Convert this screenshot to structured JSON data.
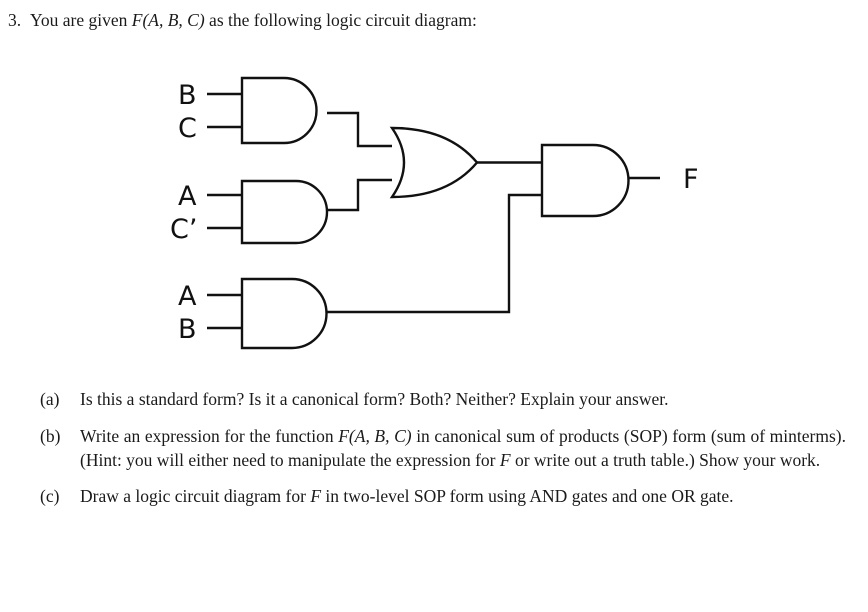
{
  "question": {
    "number": "3.",
    "stem_pre": "You are given ",
    "stem_func": "F(A, B, C)",
    "stem_post": " as the following logic circuit diagram:"
  },
  "circuit": {
    "title": "logic-circuit-diagram",
    "inputs": [
      {
        "label": "B",
        "gate": "and-gate-1",
        "pin": "top"
      },
      {
        "label": "C",
        "gate": "and-gate-1",
        "pin": "bottom"
      },
      {
        "label": "A",
        "gate": "and-gate-2",
        "pin": "top"
      },
      {
        "label": "C’",
        "gate": "and-gate-2",
        "pin": "bottom"
      },
      {
        "label": "A",
        "gate": "and-gate-3",
        "pin": "top"
      },
      {
        "label": "B",
        "gate": "and-gate-3",
        "pin": "bottom"
      }
    ],
    "gates": [
      {
        "name": "and-gate-1",
        "type": "AND",
        "inputs": [
          "B",
          "C"
        ]
      },
      {
        "name": "and-gate-2",
        "type": "AND",
        "inputs": [
          "A",
          "C’"
        ]
      },
      {
        "name": "and-gate-3",
        "type": "AND",
        "inputs": [
          "A",
          "B"
        ]
      },
      {
        "name": "or-gate-1",
        "type": "OR",
        "inputs": [
          "and-gate-1",
          "and-gate-2"
        ]
      },
      {
        "name": "and-gate-4",
        "type": "AND",
        "inputs": [
          "or-gate-1",
          "and-gate-3"
        ]
      }
    ],
    "output": {
      "label": "F",
      "from": "and-gate-4"
    },
    "stroke_color": "#111111"
  },
  "parts": [
    {
      "marker": "(a)",
      "text": "Is this a standard form?  Is it a canonical form?  Both?  Neither?  Explain your answer."
    },
    {
      "marker": "(b)",
      "text_1": "Write an expression for the function ",
      "text_func": "F(A, B, C)",
      "text_2": " in canonical sum of products (SOP) form (sum of minterms).  (Hint: you will either need to manipulate the expression for ",
      "text_var": "F",
      "text_3": " or write out a truth table.)  Show your work."
    },
    {
      "marker": "(c)",
      "text_1": "Draw a logic circuit diagram for ",
      "text_var": "F",
      "text_2": " in two-level SOP form using AND gates and one OR gate."
    }
  ]
}
